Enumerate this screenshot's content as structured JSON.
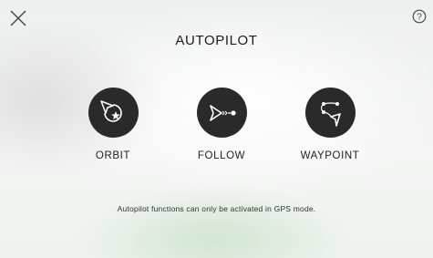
{
  "header": {
    "title": "AUTOPILOT",
    "close_icon": "close-icon",
    "help_icon": "help-icon",
    "help_glyph": "?"
  },
  "modes": [
    {
      "label": "ORBIT",
      "icon": "orbit-icon"
    },
    {
      "label": "FOLLOW",
      "icon": "follow-icon"
    },
    {
      "label": "WAYPOINT",
      "icon": "waypoint-icon"
    }
  ],
  "notice": "Autopilot functions can only be activated in GPS mode.",
  "colors": {
    "icon_circle": "#2a2a2a",
    "icon_glyph": "#ffffff",
    "text": "#1d1d1d"
  }
}
